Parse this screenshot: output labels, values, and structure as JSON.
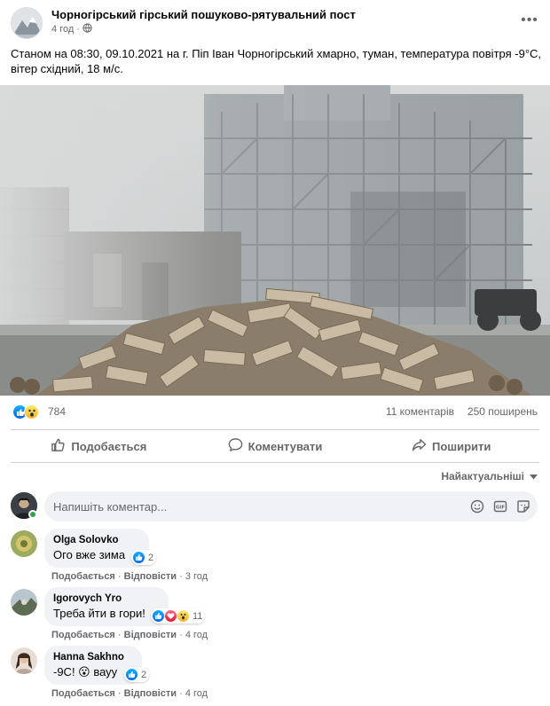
{
  "post": {
    "page_name": "Чорногірський гірський пошуково-рятувальний пост",
    "time": "4 год",
    "privacy_icon": "globe-icon",
    "text": "Станом на 08:30, 09.10.2021 на г. Піп Іван Чорногірський хмарно, туман,  температура повітря -9°C, вітер східний, 18 м/с."
  },
  "stats": {
    "reaction_icons": [
      "like-icon",
      "wow-icon"
    ],
    "reactions_count": "784",
    "comments_count": "11 коментарів",
    "shares_count": "250 поширень"
  },
  "actions": {
    "like": "Подобається",
    "comment": "Коментувати",
    "share": "Поширити"
  },
  "sort": {
    "label": "Найактуальніші"
  },
  "composer": {
    "placeholder": "Напишіть коментар..."
  },
  "comments": [
    {
      "author": "Olga Solovko",
      "text": "Ого вже зима",
      "reaction_count": "2",
      "like_label": "Подобається",
      "reply_label": "Відповісти",
      "time": "3 год"
    },
    {
      "author": "Igorovych Yro",
      "text": "Треба йти в гори!",
      "reaction_count": "11",
      "like_label": "Подобається",
      "reply_label": "Відповісти",
      "time": "4 год"
    },
    {
      "author": "Hanna Sakhno",
      "text": "-9С! 😮 вауу",
      "reaction_count": "2",
      "like_label": "Подобається",
      "reply_label": "Відповісти",
      "time": "4 год"
    }
  ],
  "colors": {
    "like_blue": "#1877f2",
    "secondary_text": "#65676b",
    "bubble_bg": "#f0f2f5",
    "online_green": "#31a24c"
  }
}
